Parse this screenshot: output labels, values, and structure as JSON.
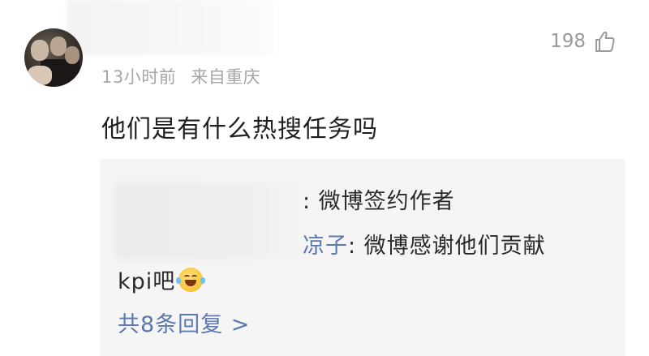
{
  "comment": {
    "time": "13小时前",
    "location": "来自重庆",
    "like_count": "198",
    "text": "他们是有什么热搜任务吗"
  },
  "replies": {
    "reply1": {
      "text": ": 微博签约作者"
    },
    "reply2": {
      "author_suffix": "凉子",
      "text": ": 微博感谢他们贡献",
      "text_line2": "kpi吧"
    },
    "more_label": "共8条回复 >"
  },
  "colors": {
    "link_blue": "#5b79b0",
    "meta_gray": "#a6a6a6",
    "reply_bg": "#f5f5f5"
  },
  "icons": {
    "like": "thumbs-up-icon",
    "emoji": "laugh-cry-emoji-icon"
  }
}
